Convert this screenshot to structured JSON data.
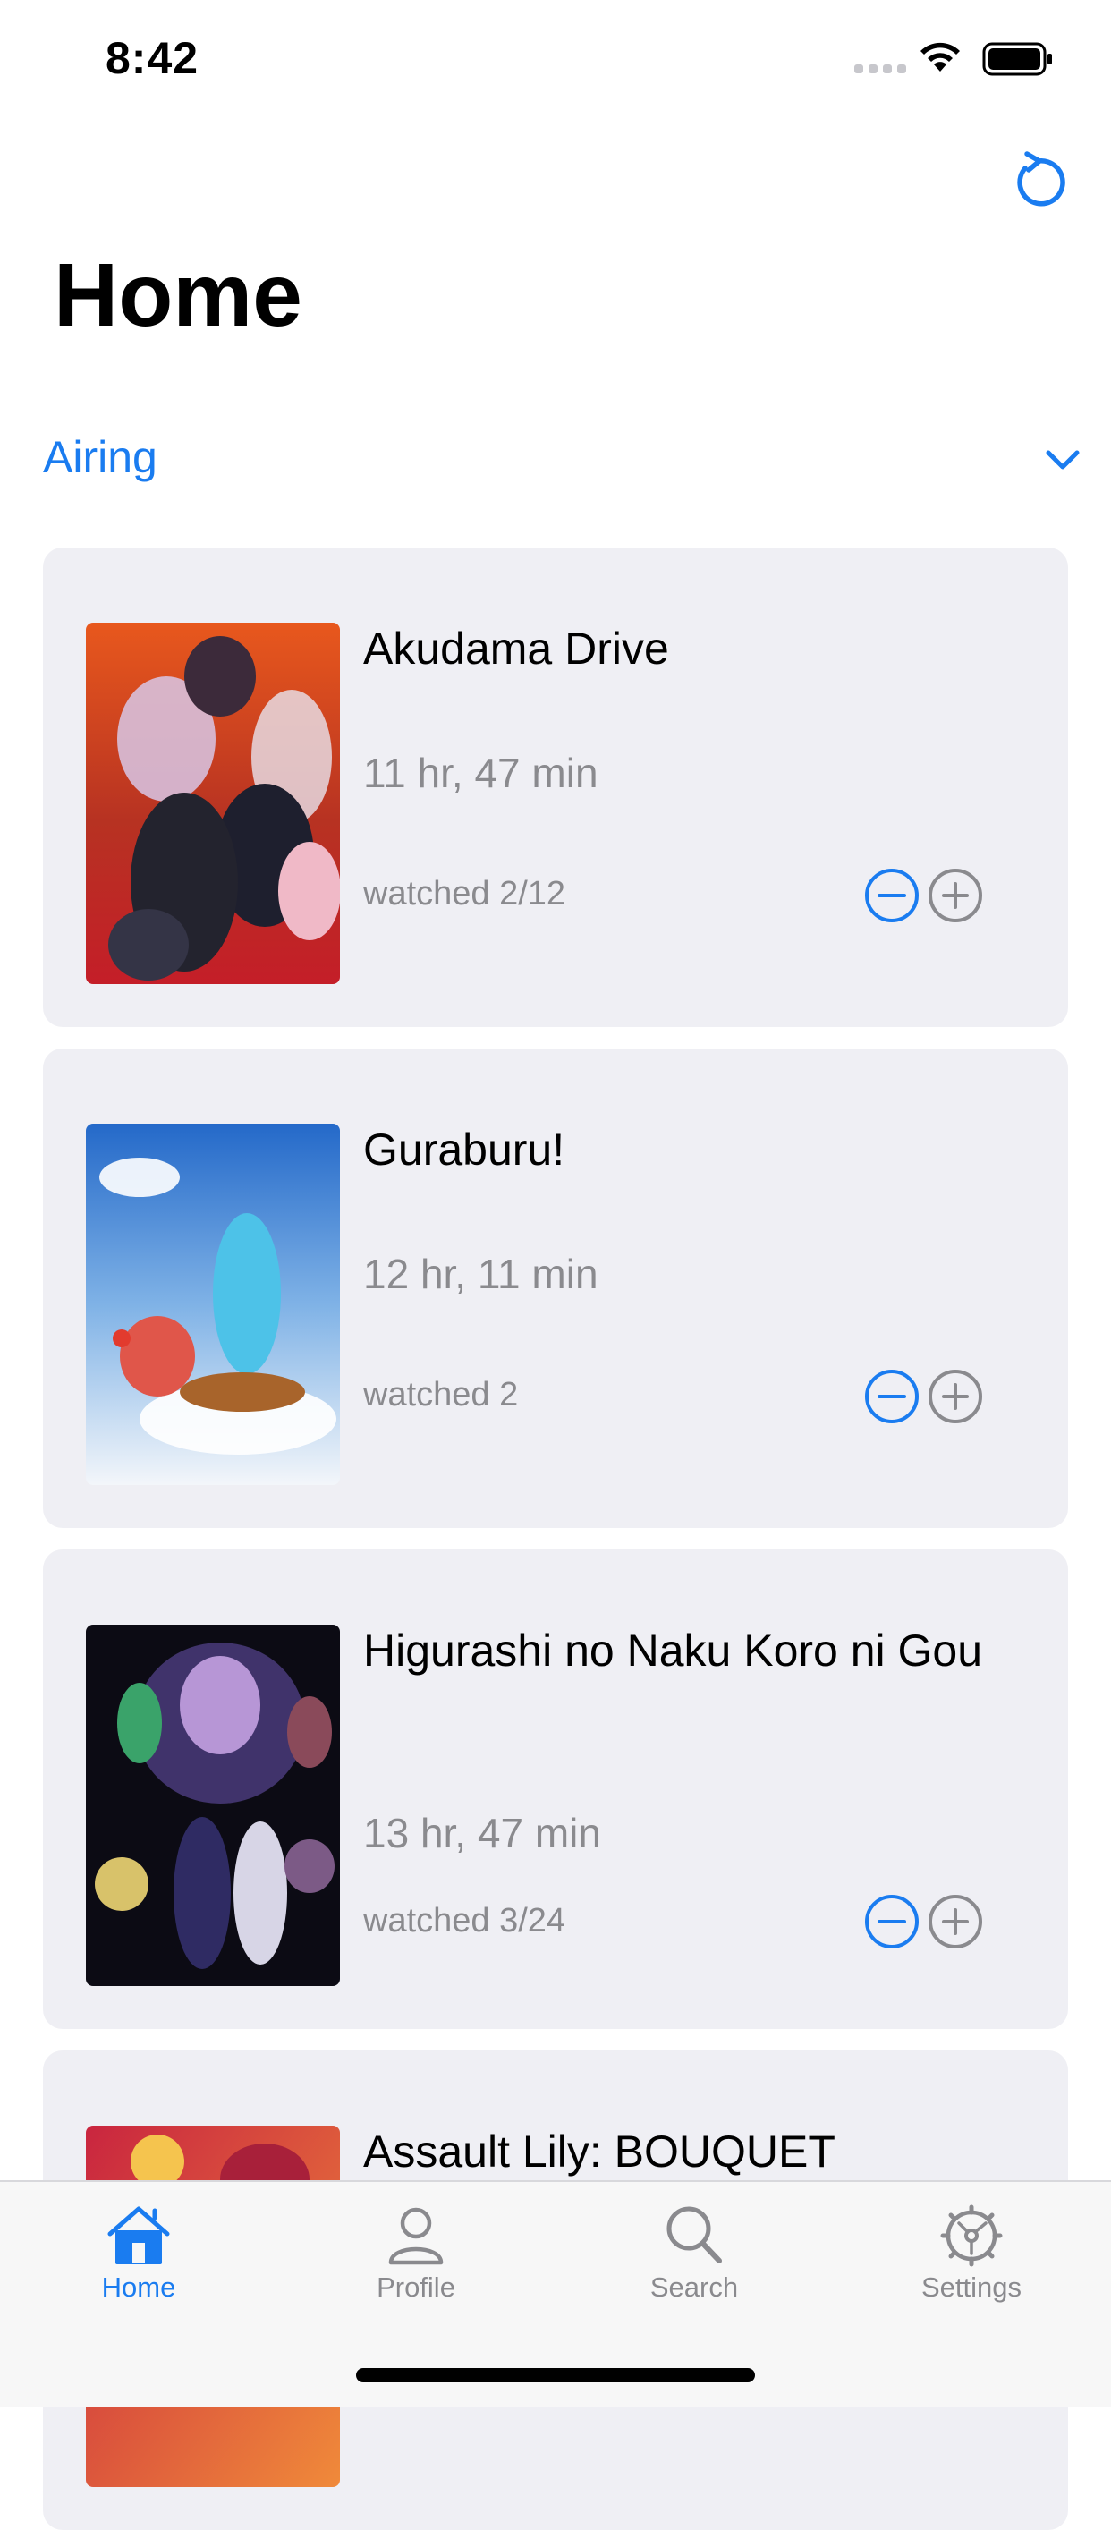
{
  "status_bar": {
    "time": "8:42"
  },
  "header": {
    "title": "Home"
  },
  "section": {
    "label": "Airing"
  },
  "cards": [
    {
      "title": "Akudama Drive",
      "duration": "11 hr, 47 min",
      "watched": "watched 2/12"
    },
    {
      "title": "Guraburu!",
      "duration": "12 hr, 11 min",
      "watched": "watched 2"
    },
    {
      "title": "Higurashi no Naku Koro ni Gou",
      "duration": "13 hr, 47 min",
      "watched": "watched 3/24"
    },
    {
      "title": "Assault Lily: BOUQUET"
    }
  ],
  "tabs": [
    {
      "label": "Home",
      "icon": "house-icon",
      "active": true
    },
    {
      "label": "Profile",
      "icon": "person-icon",
      "active": false
    },
    {
      "label": "Search",
      "icon": "magnifier-icon",
      "active": false
    },
    {
      "label": "Settings",
      "icon": "gear-icon",
      "active": false
    }
  ],
  "colors": {
    "accent": "#1a7cf0",
    "card_bg": "#efeff4",
    "secondary_text": "#8a8a8e",
    "disabled_icon": "#8a8a8e"
  }
}
